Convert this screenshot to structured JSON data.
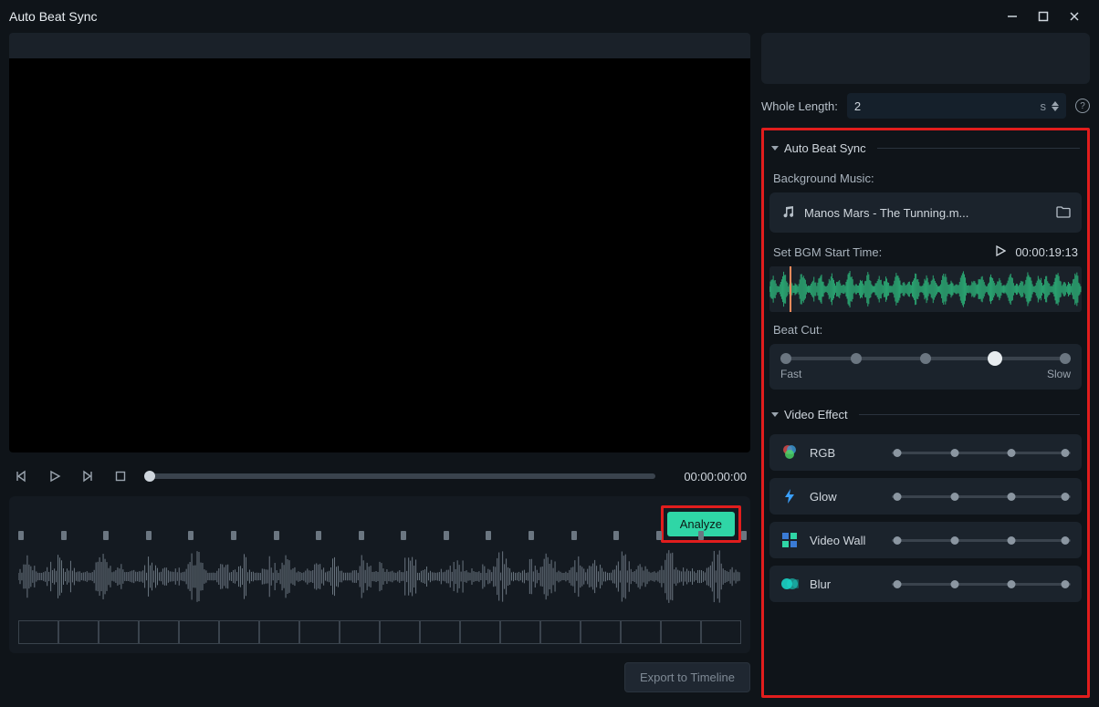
{
  "title": "Auto Beat Sync",
  "whole_length": {
    "label": "Whole Length:",
    "value": "2",
    "unit": "s"
  },
  "preview": {
    "timecode": "00:00:00:00"
  },
  "analyze_label": "Analyze",
  "export_label": "Export to Timeline",
  "section_autobeat": {
    "title": "Auto Beat Sync",
    "bg_label": "Background Music:",
    "music_name": "Manos Mars - The Tunning.m...",
    "set_start_label": "Set BGM Start Time:",
    "start_time": "00:00:19:13",
    "beat_cut_label": "Beat Cut:",
    "fast": "Fast",
    "slow": "Slow"
  },
  "section_fx": {
    "title": "Video Effect",
    "items": [
      {
        "name": "RGB"
      },
      {
        "name": "Glow"
      },
      {
        "name": "Video Wall"
      },
      {
        "name": "Blur"
      }
    ]
  },
  "colors": {
    "accent": "#2fd6a6",
    "highlight": "#e11d1d"
  }
}
